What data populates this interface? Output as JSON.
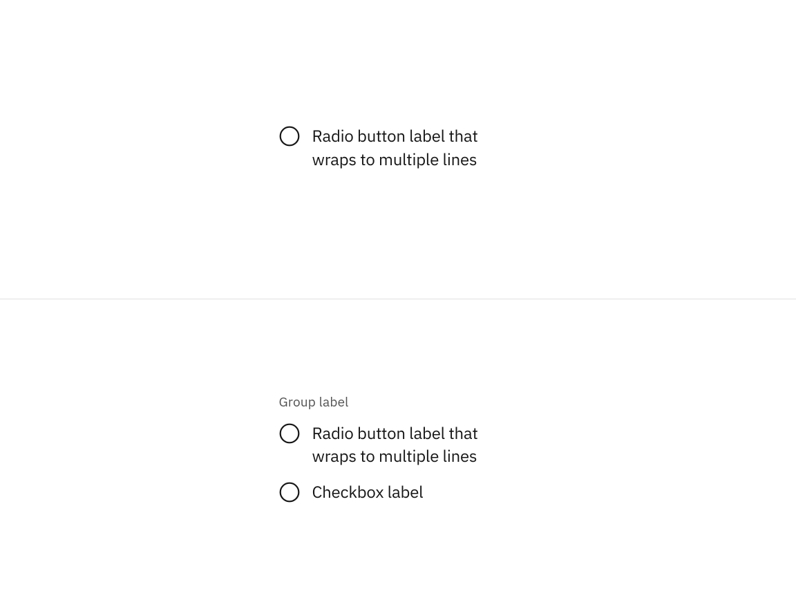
{
  "top": {
    "radio1_label": "Radio button label that wraps to multiple lines"
  },
  "bottom": {
    "group_label": "Group label",
    "radio1_label": "Radio button label that wraps to multiple lines",
    "radio2_label": "Checkbox label"
  }
}
